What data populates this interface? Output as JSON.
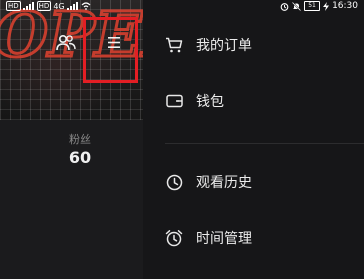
{
  "status_bar": {
    "left_tags": [
      "HD",
      "HD"
    ],
    "left_signal": "4G",
    "battery": "51",
    "time": "16:30"
  },
  "profile": {
    "cover_text": "OPEN",
    "stats": [
      {
        "label": "粉丝",
        "value": "60"
      }
    ]
  },
  "drawer": {
    "items": [
      {
        "label": "我的订单",
        "icon": "cart-icon"
      },
      {
        "label": "钱包",
        "icon": "wallet-icon"
      },
      {
        "label": "观看历史",
        "icon": "clock-icon"
      },
      {
        "label": "时间管理",
        "icon": "alarm-clock-icon"
      }
    ]
  },
  "colors": {
    "highlight_border": "#e31e24",
    "background": "#161616",
    "neon": "#d6402f"
  }
}
